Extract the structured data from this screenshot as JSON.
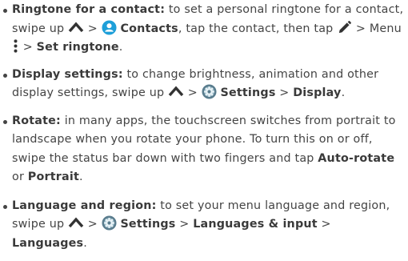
{
  "items": [
    {
      "title": "Ringtone for a contact:",
      "t1": " to set a personal ringtone for a contact, swipe up ",
      "t2": " > ",
      "contacts": "Contacts",
      "t3": ", tap the contact, then tap ",
      "t4": " > Menu ",
      "t5": " > ",
      "set_ringtone": "Set ringtone",
      "t6": "."
    },
    {
      "title": "Display settings:",
      "t1": " to change brightness, animation and other display settings, swipe up ",
      "t2": " > ",
      "settings": "Settings",
      "t3": " > ",
      "display": "Display",
      "t4": "."
    },
    {
      "title": "Rotate:",
      "t1": " in many apps, the touchscreen switches from portrait to landscape when you rotate your phone. To turn this on or off, swipe the status bar down with two fingers and tap ",
      "auto_rotate": "Auto-rotate",
      "t2": " or ",
      "portrait": "Portrait",
      "t3": "."
    },
    {
      "title": "Language and region:",
      "t1": " to set your menu language and region, swipe up ",
      "t2": " > ",
      "settings": "Settings",
      "t3": " > ",
      "languages_input": "Languages & input",
      "t4": " > ",
      "languages": "Languages",
      "t5": "."
    }
  ],
  "icons": {
    "chevron_up": "chevron-up-icon",
    "contacts": "contacts-app-icon",
    "edit": "pencil-icon",
    "menu": "more-vertical-icon",
    "settings": "settings-gear-icon",
    "contacts_color": "#1e9fd9",
    "settings_color": "#5a7d8e"
  }
}
